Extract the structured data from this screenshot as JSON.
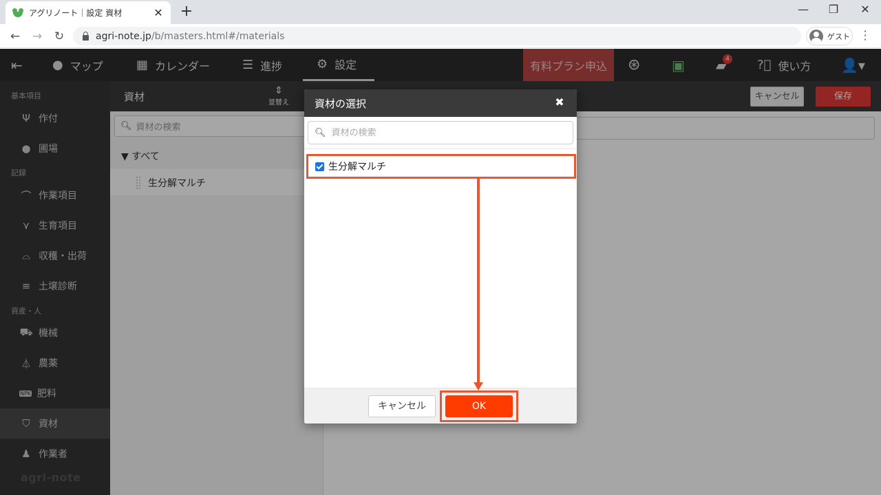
{
  "browser": {
    "tab_title": "アグリノート｜設定 資材",
    "url_host": "agri-note.jp",
    "url_path": "/b/masters.html#/materials",
    "guest_label": "ゲスト"
  },
  "header": {
    "nav": [
      {
        "label": "マップ",
        "icon": "map-pin-icon"
      },
      {
        "label": "カレンダー",
        "icon": "calendar-icon"
      },
      {
        "label": "進捗",
        "icon": "checklist-icon"
      },
      {
        "label": "設定",
        "icon": "gear-icon"
      }
    ],
    "plan_button": "有料プラン申込",
    "notification_count": "4",
    "help_label": "使い方"
  },
  "sidebar": {
    "sections": [
      "基本項目",
      "記録",
      "資産・人"
    ],
    "items": [
      {
        "label": "作付",
        "icon": "sprout-icon"
      },
      {
        "label": "圃場",
        "icon": "map-pin-icon"
      },
      {
        "label": "作業項目",
        "icon": "sickle-icon"
      },
      {
        "label": "生育項目",
        "icon": "grass-icon"
      },
      {
        "label": "収穫・出荷",
        "icon": "basket-icon"
      },
      {
        "label": "土壌診断",
        "icon": "sliders-icon"
      },
      {
        "label": "機械",
        "icon": "tractor-icon"
      },
      {
        "label": "農薬",
        "icon": "flask-icon"
      },
      {
        "label": "肥料",
        "icon": "npk-icon"
      },
      {
        "label": "資材",
        "icon": "material-icon"
      },
      {
        "label": "作業者",
        "icon": "person-icon"
      }
    ],
    "logo": "agri-note",
    "active_item": "資材"
  },
  "main": {
    "title": "資材",
    "sort_label": "並替え",
    "cancel_label": "キャンセル",
    "save_label": "保存",
    "search_placeholder": "資材の検索",
    "tree_root": "▼ すべて",
    "rows": [
      "生分解マルチ"
    ]
  },
  "modal": {
    "title": "資材の選択",
    "search_placeholder": "資材の検索",
    "items": [
      {
        "label": "生分解マルチ",
        "checked": true
      }
    ],
    "cancel_label": "キャンセル",
    "ok_label": "OK"
  },
  "colors": {
    "accent": "#ff3b00",
    "annotation": "#e8572f",
    "plan": "#b94646",
    "save": "#e53935"
  }
}
